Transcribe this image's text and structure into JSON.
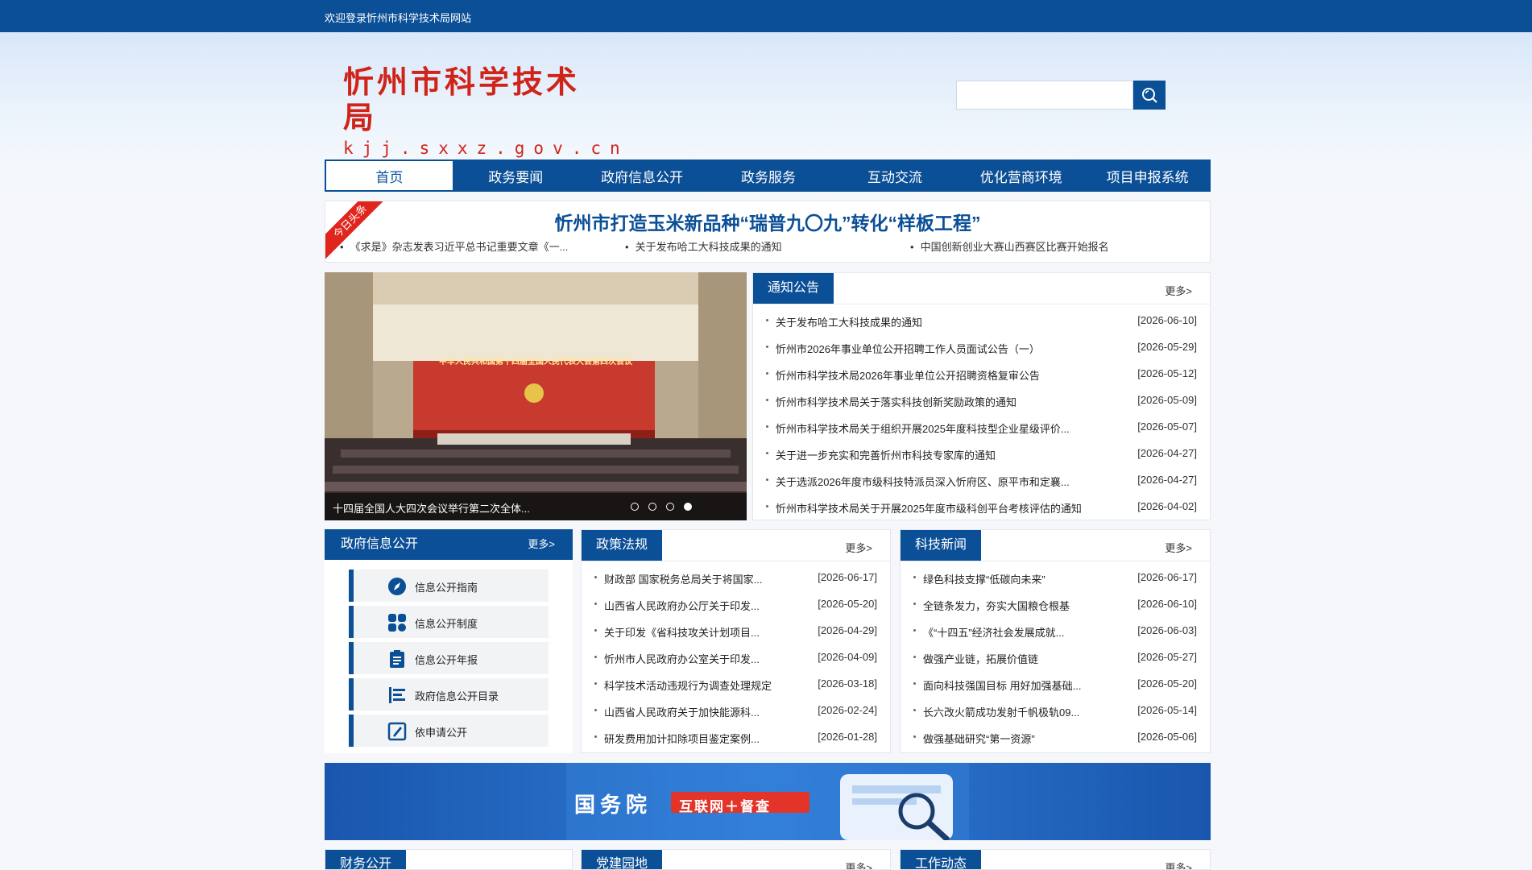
{
  "topbar": {
    "welcome": "欢迎登录忻州市科学技术局网站"
  },
  "logo": {
    "cn": "忻州市科学技术局",
    "en": "kjj.sxxz.gov.cn"
  },
  "search": {
    "placeholder": "",
    "icon": "search-icon"
  },
  "nav": [
    "首页",
    "政务要闻",
    "政府信息公开",
    "政务服务",
    "互动交流",
    "优化营商环境",
    "项目申报系统"
  ],
  "headline": {
    "ribbon": "今日头条",
    "title": "忻州市打造玉米新品种“瑞普九〇九”转化“样板工程”",
    "items": [
      "《求是》杂志发表习近平总书记重要文章《一...",
      "关于发布哈工大科技成果的通知",
      "中国创新创业大赛山西赛区比赛开始报名"
    ]
  },
  "slider": {
    "banner_text": "中华人民共和国第十四届全国人民代表大会第四次会议",
    "caption": "十四届全国人大四次会议举行第二次全体...",
    "dots_total": 4,
    "dots_active": 4
  },
  "notice": {
    "tab": "通知公告",
    "more": "更多>",
    "items": [
      {
        "title": "关于发布哈工大科技成果的通知",
        "date": "[2026-06-10]"
      },
      {
        "title": "忻州市2026年事业单位公开招聘工作人员面试公告（一）",
        "date": "[2026-05-29]"
      },
      {
        "title": "忻州市科学技术局2026年事业单位公开招聘资格复审公告",
        "date": "[2026-05-12]"
      },
      {
        "title": "忻州市科学技术局关于落实科技创新奖励政策的通知",
        "date": "[2026-05-09]"
      },
      {
        "title": "忻州市科学技术局关于组织开展2025年度科技型企业星级评价...",
        "date": "[2026-05-07]"
      },
      {
        "title": "关于进一步充实和完善忻州市科技专家库的通知",
        "date": "[2026-04-27]"
      },
      {
        "title": "关于选派2026年度市级科技特派员深入忻府区、原平市和定襄...",
        "date": "[2026-04-27]"
      },
      {
        "title": "忻州市科学技术局关于开展2025年度市级科创平台考核评估的通知",
        "date": "[2026-04-02]"
      }
    ]
  },
  "gov_info": {
    "title": "政府信息公开",
    "more": "更多>",
    "items": [
      {
        "label": "信息公开指南",
        "icon": "compass-icon"
      },
      {
        "label": "信息公开制度",
        "icon": "grid-icon"
      },
      {
        "label": "信息公开年报",
        "icon": "clipboard-icon"
      },
      {
        "label": "政府信息公开目录",
        "icon": "list-icon"
      },
      {
        "label": "依申请公开",
        "icon": "edit-icon"
      }
    ]
  },
  "policy": {
    "tab": "政策法规",
    "more": "更多>",
    "items": [
      {
        "title": "财政部 国家税务总局关于将国家...",
        "date": "[2026-06-17]"
      },
      {
        "title": "山西省人民政府办公厅关于印发...",
        "date": "[2026-05-20]"
      },
      {
        "title": "关于印发《省科技攻关计划项目...",
        "date": "[2026-04-29]"
      },
      {
        "title": "忻州市人民政府办公室关于印发...",
        "date": "[2026-04-09]"
      },
      {
        "title": "科学技术活动违规行为调查处理规定",
        "date": "[2026-03-18]"
      },
      {
        "title": "山西省人民政府关于加快能源科...",
        "date": "[2026-02-24]"
      },
      {
        "title": "研发费用加计扣除项目鉴定案例...",
        "date": "[2026-01-28]"
      }
    ]
  },
  "tech_news": {
    "tab": "科技新闻",
    "more": "更多>",
    "items": [
      {
        "title": "绿色科技支撑“低碳向未来”",
        "date": "[2026-06-17]"
      },
      {
        "title": "全链条发力，夯实大国粮仓根基",
        "date": "[2026-06-10]"
      },
      {
        "title": "《“十四五”经济社会发展成就...",
        "date": "[2026-06-03]"
      },
      {
        "title": "做强产业链，拓展价值链",
        "date": "[2026-05-27]"
      },
      {
        "title": "面向科技强国目标 用好加强基础...",
        "date": "[2026-05-20]"
      },
      {
        "title": "长六改火箭成功发射千帆极轨09...",
        "date": "[2026-05-14]"
      },
      {
        "title": "做强基础研究“第一资源”",
        "date": "[2026-05-06]"
      }
    ]
  },
  "banner": {
    "main": "国务院",
    "tag": "互联网＋督查"
  },
  "bottom": [
    {
      "tab": "财务公开",
      "more": ""
    },
    {
      "tab": "党建园地",
      "more": "更多>"
    },
    {
      "tab": "工作动态",
      "more": "更多>"
    }
  ]
}
